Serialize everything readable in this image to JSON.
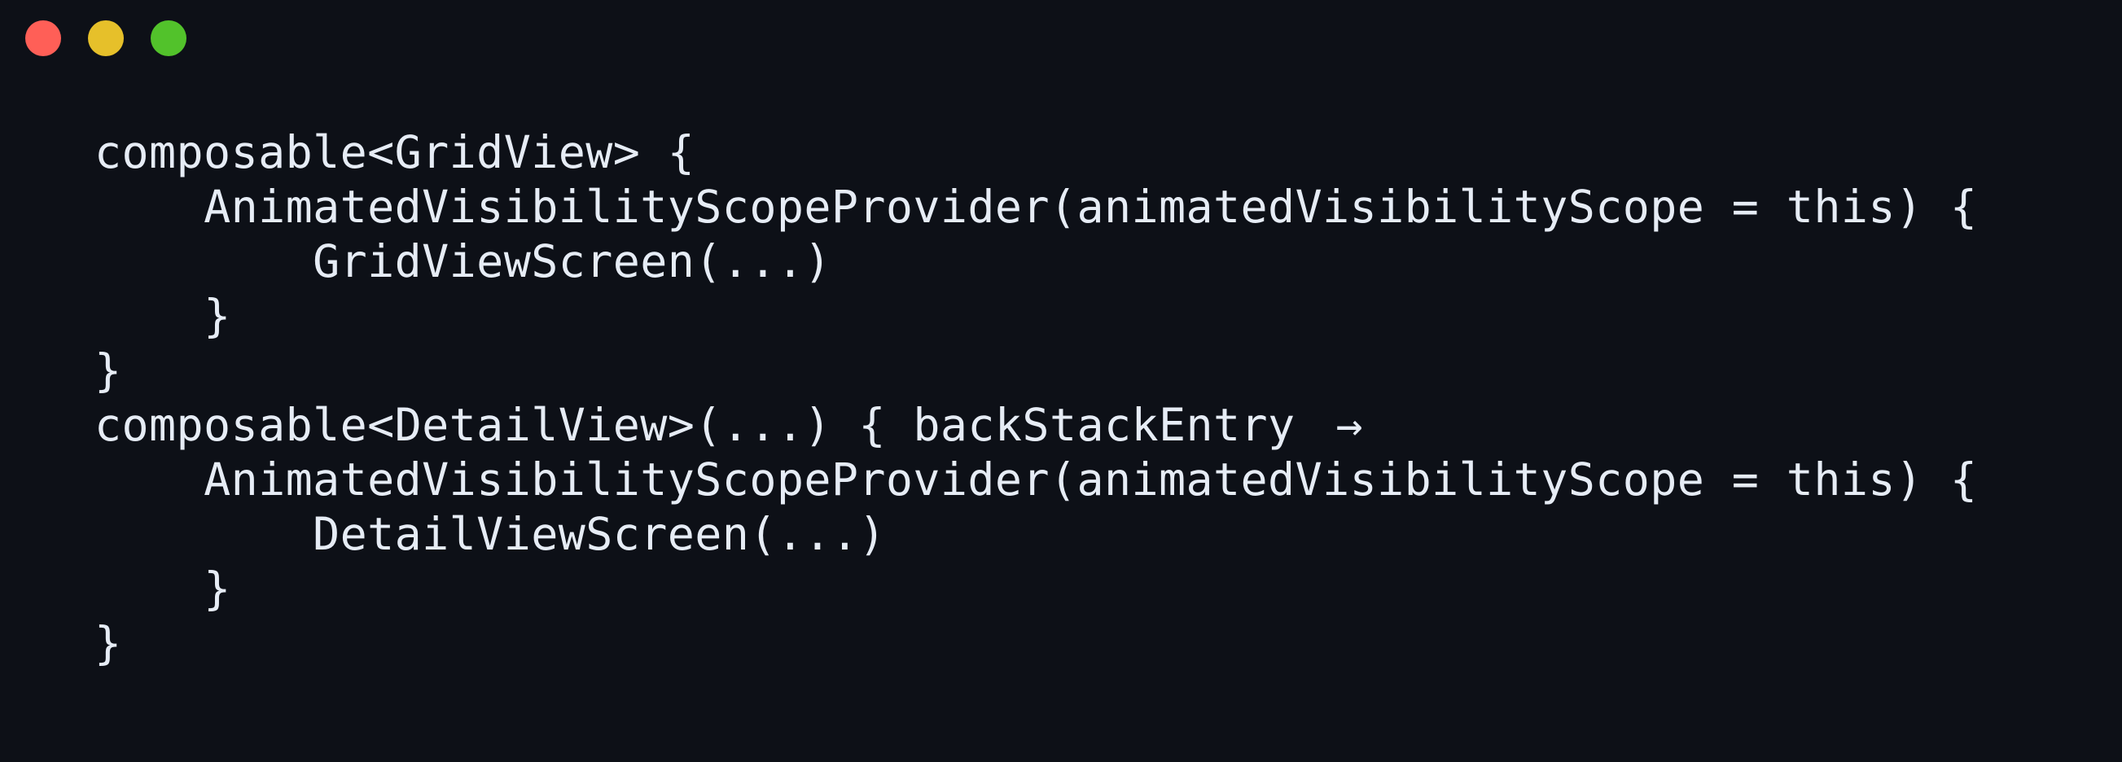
{
  "window": {
    "controls": [
      {
        "name": "close",
        "color": "#ff5f57"
      },
      {
        "name": "minimize",
        "color": "#e6c02a"
      },
      {
        "name": "maximize",
        "color": "#52c22b"
      }
    ]
  },
  "code": {
    "lines": [
      {
        "indent": "",
        "text": "composable<GridView> {"
      },
      {
        "indent": "    ",
        "text": "AnimatedVisibilityScopeProvider(animatedVisibilityScope = this) {"
      },
      {
        "indent": "        ",
        "text": "GridViewScreen(...)"
      },
      {
        "indent": "    ",
        "text": "}"
      },
      {
        "indent": "",
        "text": "}"
      },
      {
        "indent": "",
        "text": "composable<DetailView>(...) { backStackEntry ",
        "arrow": "→"
      },
      {
        "indent": "    ",
        "text": "AnimatedVisibilityScopeProvider(animatedVisibilityScope = this) {"
      },
      {
        "indent": "        ",
        "text": "DetailViewScreen(...)"
      },
      {
        "indent": "    ",
        "text": "}"
      },
      {
        "indent": "",
        "text": "}"
      }
    ]
  }
}
